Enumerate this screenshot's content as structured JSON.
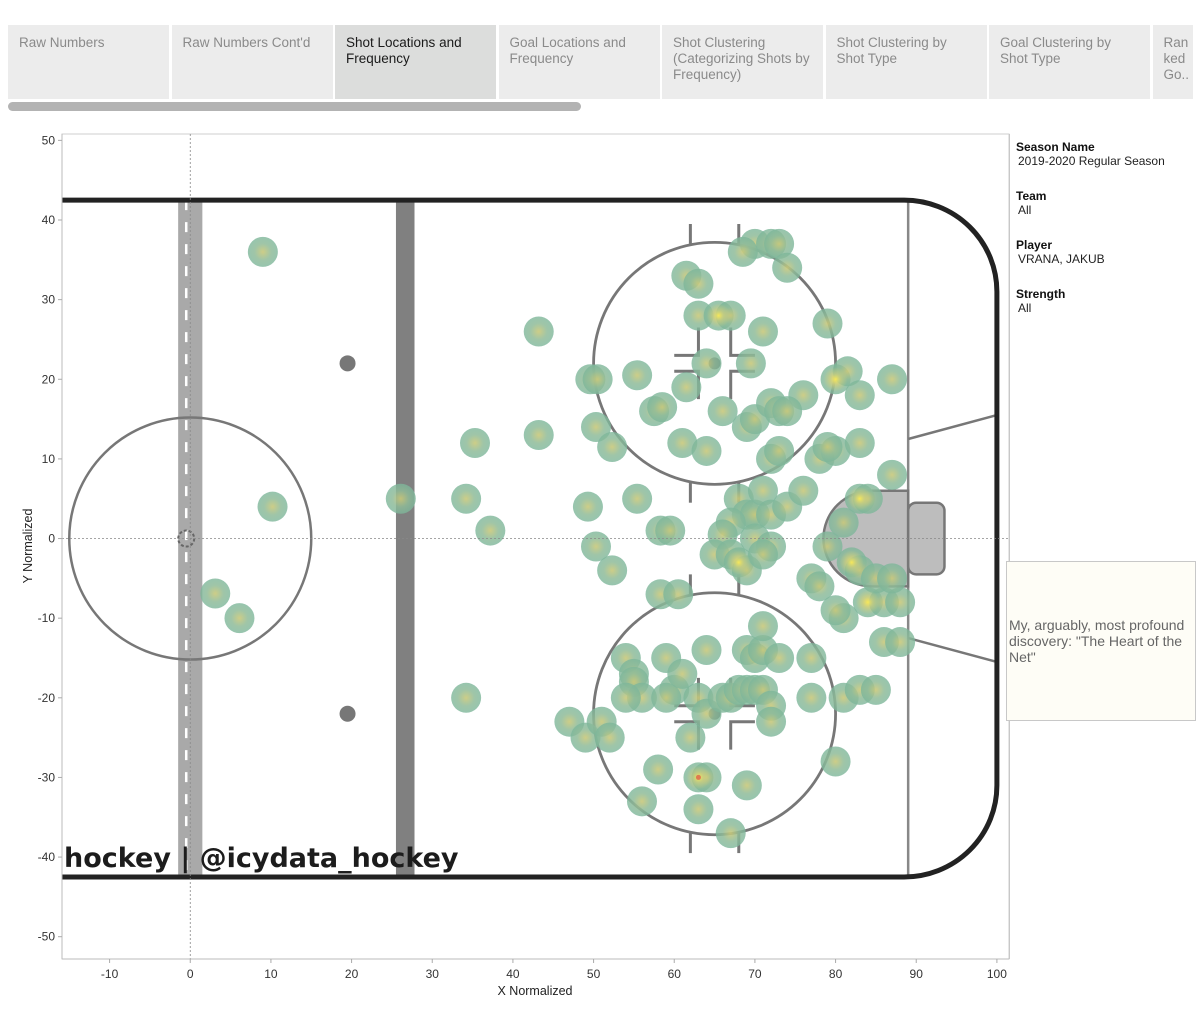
{
  "tabs": [
    {
      "label": "Raw Numbers",
      "active": false
    },
    {
      "label": "Raw Numbers Cont'd",
      "active": false
    },
    {
      "label": "Shot Locations and Frequency",
      "active": true
    },
    {
      "label": "Goal Locations and Frequency",
      "active": false
    },
    {
      "label": "Shot Clustering (Categorizing Shots by Frequency)",
      "active": false
    },
    {
      "label": "Shot Clustering by Shot Type",
      "active": false
    },
    {
      "label": "Goal Clustering by Shot Type",
      "active": false
    },
    {
      "label": "Ran ked Go..",
      "active": false
    }
  ],
  "filters": [
    {
      "label": "Season Name",
      "value": "2019-2020 Regular Season"
    },
    {
      "label": "Team",
      "value": "All"
    },
    {
      "label": "Player",
      "value": "VRANA, JAKUB"
    },
    {
      "label": "Strength",
      "value": "All"
    }
  ],
  "annotation": "My, arguably, most profound discovery: \"The Heart of the Net\"",
  "watermark": "hockey | @icydata_hockey",
  "colors": {
    "point_outer": "#7fb59a",
    "point_mid": "#a8bf8c",
    "point_hot": "#f0e060",
    "rink_board": "#222222",
    "blue_line": "#808080",
    "red_line": "#a9a9a9",
    "crease": "#bdbdbd"
  },
  "chart_data": {
    "type": "scatter",
    "title": "",
    "xlabel": "X Normalized",
    "ylabel": "Y Normalized",
    "xlim": [
      -15.9,
      101.5
    ],
    "ylim": [
      -52.8,
      50.8
    ],
    "xticks": [
      -10,
      0,
      10,
      20,
      30,
      40,
      50,
      60,
      70,
      80,
      90,
      100
    ],
    "yticks": [
      50,
      40,
      30,
      20,
      10,
      0,
      -10,
      -20,
      -30,
      -40,
      -50
    ],
    "reference_lines": {
      "x": 0,
      "y": 0
    },
    "grid": false,
    "legend": "none",
    "points": [
      [
        9,
        36
      ],
      [
        10.2,
        4
      ],
      [
        3.1,
        -6.9
      ],
      [
        6.1,
        -10
      ],
      [
        26.1,
        5
      ],
      [
        34.2,
        5
      ],
      [
        35.3,
        12
      ],
      [
        37.2,
        1
      ],
      [
        34.2,
        -20
      ],
      [
        43.2,
        26
      ],
      [
        43.2,
        13
      ],
      [
        49.3,
        4
      ],
      [
        50.3,
        -1
      ],
      [
        52.3,
        -4
      ],
      [
        50.3,
        14
      ],
      [
        52.3,
        11.5
      ],
      [
        49.6,
        20
      ],
      [
        50.5,
        20
      ],
      [
        55.4,
        20.5
      ],
      [
        55.4,
        5
      ],
      [
        58.3,
        1
      ],
      [
        59.5,
        1
      ],
      [
        58.3,
        -7
      ],
      [
        60.5,
        -7
      ],
      [
        61.5,
        33
      ],
      [
        63,
        32
      ],
      [
        63,
        28
      ],
      [
        65.5,
        28
      ],
      [
        67,
        28
      ],
      [
        64,
        22
      ],
      [
        69.5,
        22
      ],
      [
        57.5,
        16
      ],
      [
        58.5,
        16.5
      ],
      [
        61.5,
        19
      ],
      [
        66,
        16
      ],
      [
        61,
        12
      ],
      [
        64,
        11
      ],
      [
        71,
        26
      ],
      [
        70,
        37
      ],
      [
        72,
        37
      ],
      [
        73,
        37
      ],
      [
        74,
        34
      ],
      [
        68.5,
        36
      ],
      [
        79,
        27
      ],
      [
        80,
        20
      ],
      [
        81.5,
        21
      ],
      [
        83,
        18
      ],
      [
        87,
        20
      ],
      [
        69,
        14
      ],
      [
        70,
        15
      ],
      [
        72,
        17
      ],
      [
        73,
        16
      ],
      [
        76,
        18
      ],
      [
        74,
        16
      ],
      [
        78,
        10
      ],
      [
        80,
        11
      ],
      [
        83,
        12
      ],
      [
        79,
        11.5
      ],
      [
        72,
        10
      ],
      [
        73,
        11
      ],
      [
        68,
        5
      ],
      [
        69,
        3
      ],
      [
        70,
        3
      ],
      [
        71,
        6
      ],
      [
        72,
        3
      ],
      [
        74,
        4
      ],
      [
        76,
        6
      ],
      [
        67,
        2
      ],
      [
        66,
        0.5
      ],
      [
        70,
        0
      ],
      [
        72,
        -1
      ],
      [
        65,
        -2
      ],
      [
        67,
        -2
      ],
      [
        68,
        -3
      ],
      [
        69,
        -4
      ],
      [
        71,
        -2
      ],
      [
        77,
        -5
      ],
      [
        78,
        -6
      ],
      [
        79,
        -1
      ],
      [
        81,
        2
      ],
      [
        83,
        5
      ],
      [
        84,
        5
      ],
      [
        87,
        8
      ],
      [
        82,
        -3
      ],
      [
        83,
        -4
      ],
      [
        84,
        -8
      ],
      [
        86,
        -8
      ],
      [
        88,
        -8
      ],
      [
        85,
        -5
      ],
      [
        87,
        -5
      ],
      [
        86,
        -13
      ],
      [
        88,
        -13
      ],
      [
        81,
        -10
      ],
      [
        80,
        -9
      ],
      [
        54,
        -15
      ],
      [
        55,
        -17
      ],
      [
        55,
        -18
      ],
      [
        56,
        -20
      ],
      [
        54,
        -20
      ],
      [
        59,
        -15
      ],
      [
        60,
        -19
      ],
      [
        59,
        -20
      ],
      [
        61,
        -17
      ],
      [
        64,
        -14
      ],
      [
        63,
        -20
      ],
      [
        64,
        -22
      ],
      [
        62,
        -25
      ],
      [
        58,
        -29
      ],
      [
        63,
        -30
      ],
      [
        64,
        -30
      ],
      [
        63,
        -34
      ],
      [
        69,
        -31
      ],
      [
        67,
        -37
      ],
      [
        56,
        -33
      ],
      [
        47,
        -23
      ],
      [
        49,
        -25
      ],
      [
        51,
        -23
      ],
      [
        52,
        -25
      ],
      [
        66,
        -20
      ],
      [
        67,
        -20
      ],
      [
        68,
        -19
      ],
      [
        69,
        -19
      ],
      [
        70,
        -19
      ],
      [
        71,
        -19
      ],
      [
        72,
        -21
      ],
      [
        72,
        -23
      ],
      [
        69,
        -14
      ],
      [
        70,
        -15
      ],
      [
        71,
        -14
      ],
      [
        71,
        -11
      ],
      [
        73,
        -15
      ],
      [
        77,
        -15
      ],
      [
        77,
        -20
      ],
      [
        81,
        -20
      ],
      [
        83,
        -19
      ],
      [
        80,
        -28
      ],
      [
        85,
        -19
      ]
    ],
    "hot_points": [
      [
        63,
        -30
      ],
      [
        80,
        20
      ],
      [
        84,
        -8
      ],
      [
        83,
        5
      ],
      [
        65.5,
        28
      ],
      [
        68,
        -3
      ],
      [
        82,
        -3
      ]
    ]
  }
}
